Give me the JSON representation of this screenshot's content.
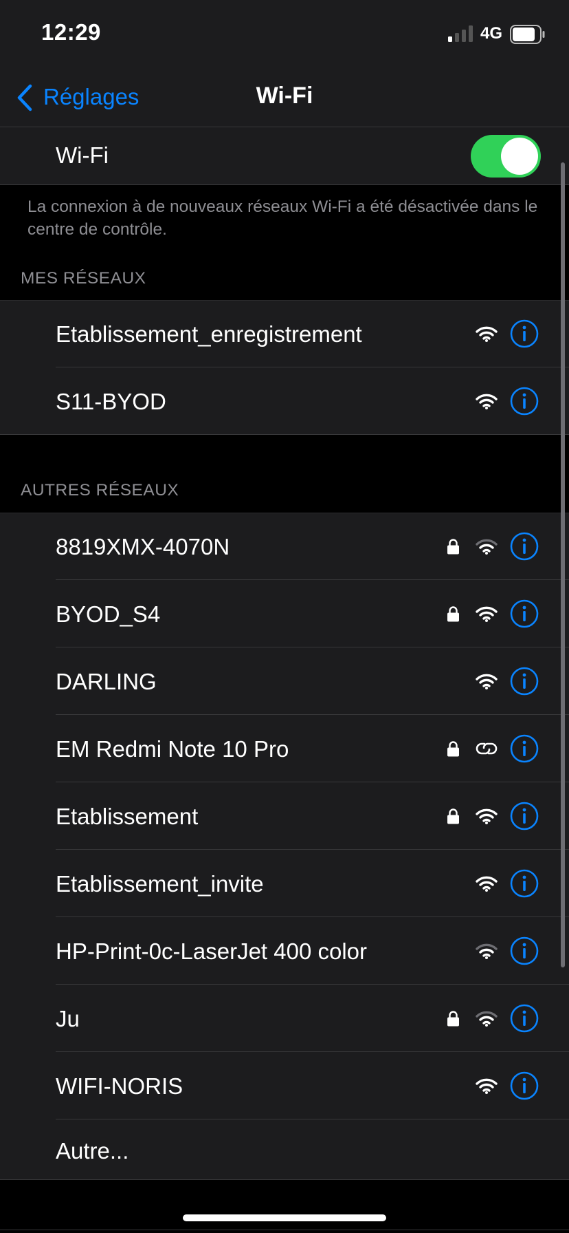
{
  "status_bar": {
    "time": "12:29",
    "network_type": "4G"
  },
  "nav": {
    "back_label": "Réglages",
    "title": "Wi-Fi"
  },
  "wifi_toggle": {
    "label": "Wi-Fi",
    "on": true,
    "color": "#30d158"
  },
  "footnote": "La connexion à de nouveaux réseaux Wi-Fi a été désactivée dans le centre de contrôle.",
  "my_networks": {
    "header": "MES RÉSEAUX",
    "items": [
      {
        "name": "Etablissement_enregistrement",
        "locked": false,
        "icon": "wifi-icon"
      },
      {
        "name": "S11-BYOD",
        "locked": false,
        "icon": "wifi-icon"
      }
    ]
  },
  "other_networks": {
    "header": "AUTRES RÉSEAUX",
    "items": [
      {
        "name": "8819XMX-4070N",
        "locked": true,
        "icon": "wifi-icon"
      },
      {
        "name": "BYOD_S4",
        "locked": true,
        "icon": "wifi-icon"
      },
      {
        "name": "DARLING",
        "locked": false,
        "icon": "wifi-icon"
      },
      {
        "name": "EM Redmi Note 10 Pro",
        "locked": true,
        "icon": "personal-hotspot-link-icon"
      },
      {
        "name": "Etablissement",
        "locked": true,
        "icon": "wifi-icon"
      },
      {
        "name": "Etablissement_invite",
        "locked": false,
        "icon": "wifi-icon"
      },
      {
        "name": "HP-Print-0c-LaserJet 400 color",
        "locked": false,
        "icon": "wifi-icon"
      },
      {
        "name": "Ju",
        "locked": true,
        "icon": "wifi-icon"
      },
      {
        "name": "WIFI-NORIS",
        "locked": false,
        "icon": "wifi-icon"
      }
    ],
    "other_label": "Autre..."
  },
  "colors": {
    "accent": "#0a84ff",
    "background": "#000000",
    "cell_background": "#1c1c1e",
    "secondary_text": "#8e8e93"
  }
}
